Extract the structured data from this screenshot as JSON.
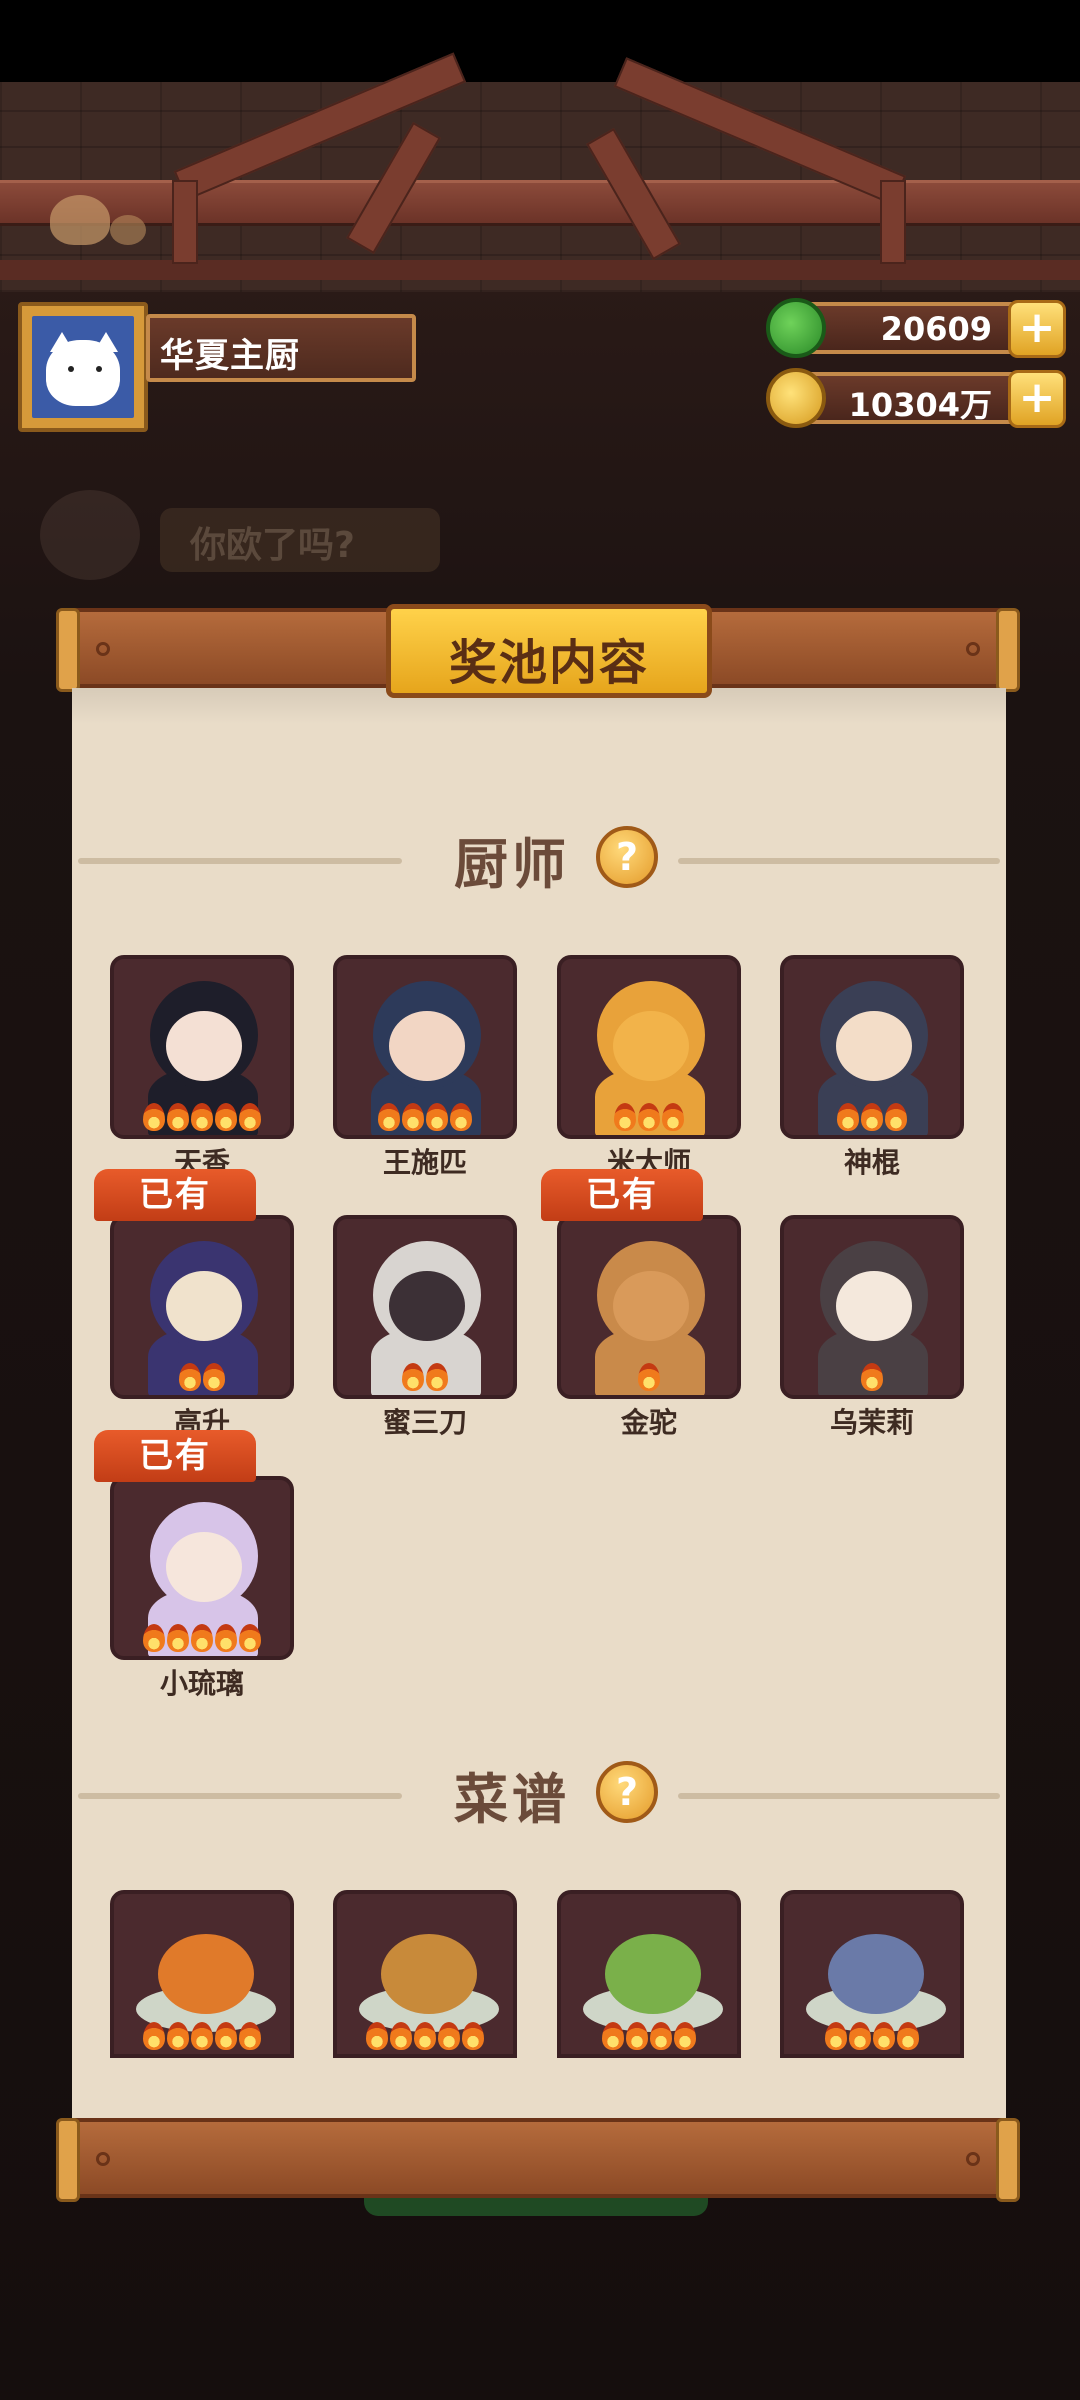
{
  "player": {
    "name": "华夏主厨"
  },
  "currencies": [
    {
      "icon": "jade-coin-icon",
      "value": "20609",
      "color": "#3cab3a"
    },
    {
      "icon": "gold-coin-icon",
      "value": "10304万",
      "color": "#f0c030"
    }
  ],
  "background_bubble": {
    "text": "你欧了吗?"
  },
  "panel": {
    "title": "奖池内容",
    "chef_section": {
      "title": "厨师",
      "help": "?"
    },
    "recipe_section": {
      "title": "菜谱",
      "help": "?"
    }
  },
  "owned_label": "已有",
  "chefs": [
    {
      "name": "天香",
      "stars": 5,
      "owned": false
    },
    {
      "name": "王施匹",
      "stars": 4,
      "owned": false
    },
    {
      "name": "米大师",
      "stars": 3,
      "owned": false
    },
    {
      "name": "神棍",
      "stars": 3,
      "owned": false
    },
    {
      "name": "高升",
      "stars": 2,
      "owned": true
    },
    {
      "name": "蜜三刀",
      "stars": 2,
      "owned": false
    },
    {
      "name": "金驼",
      "stars": 1,
      "owned": true
    },
    {
      "name": "乌茉莉",
      "stars": 1,
      "owned": false
    },
    {
      "name": "小琉璃",
      "stars": 5,
      "owned": true
    }
  ],
  "recipes": [
    {
      "icon": "phoenix-dish-icon",
      "stars": 5
    },
    {
      "icon": "grill-dish-icon",
      "stars": 5
    },
    {
      "icon": "salad-dish-icon",
      "stars": 4
    },
    {
      "icon": "noodle-bowl-icon",
      "stars": 4
    }
  ]
}
